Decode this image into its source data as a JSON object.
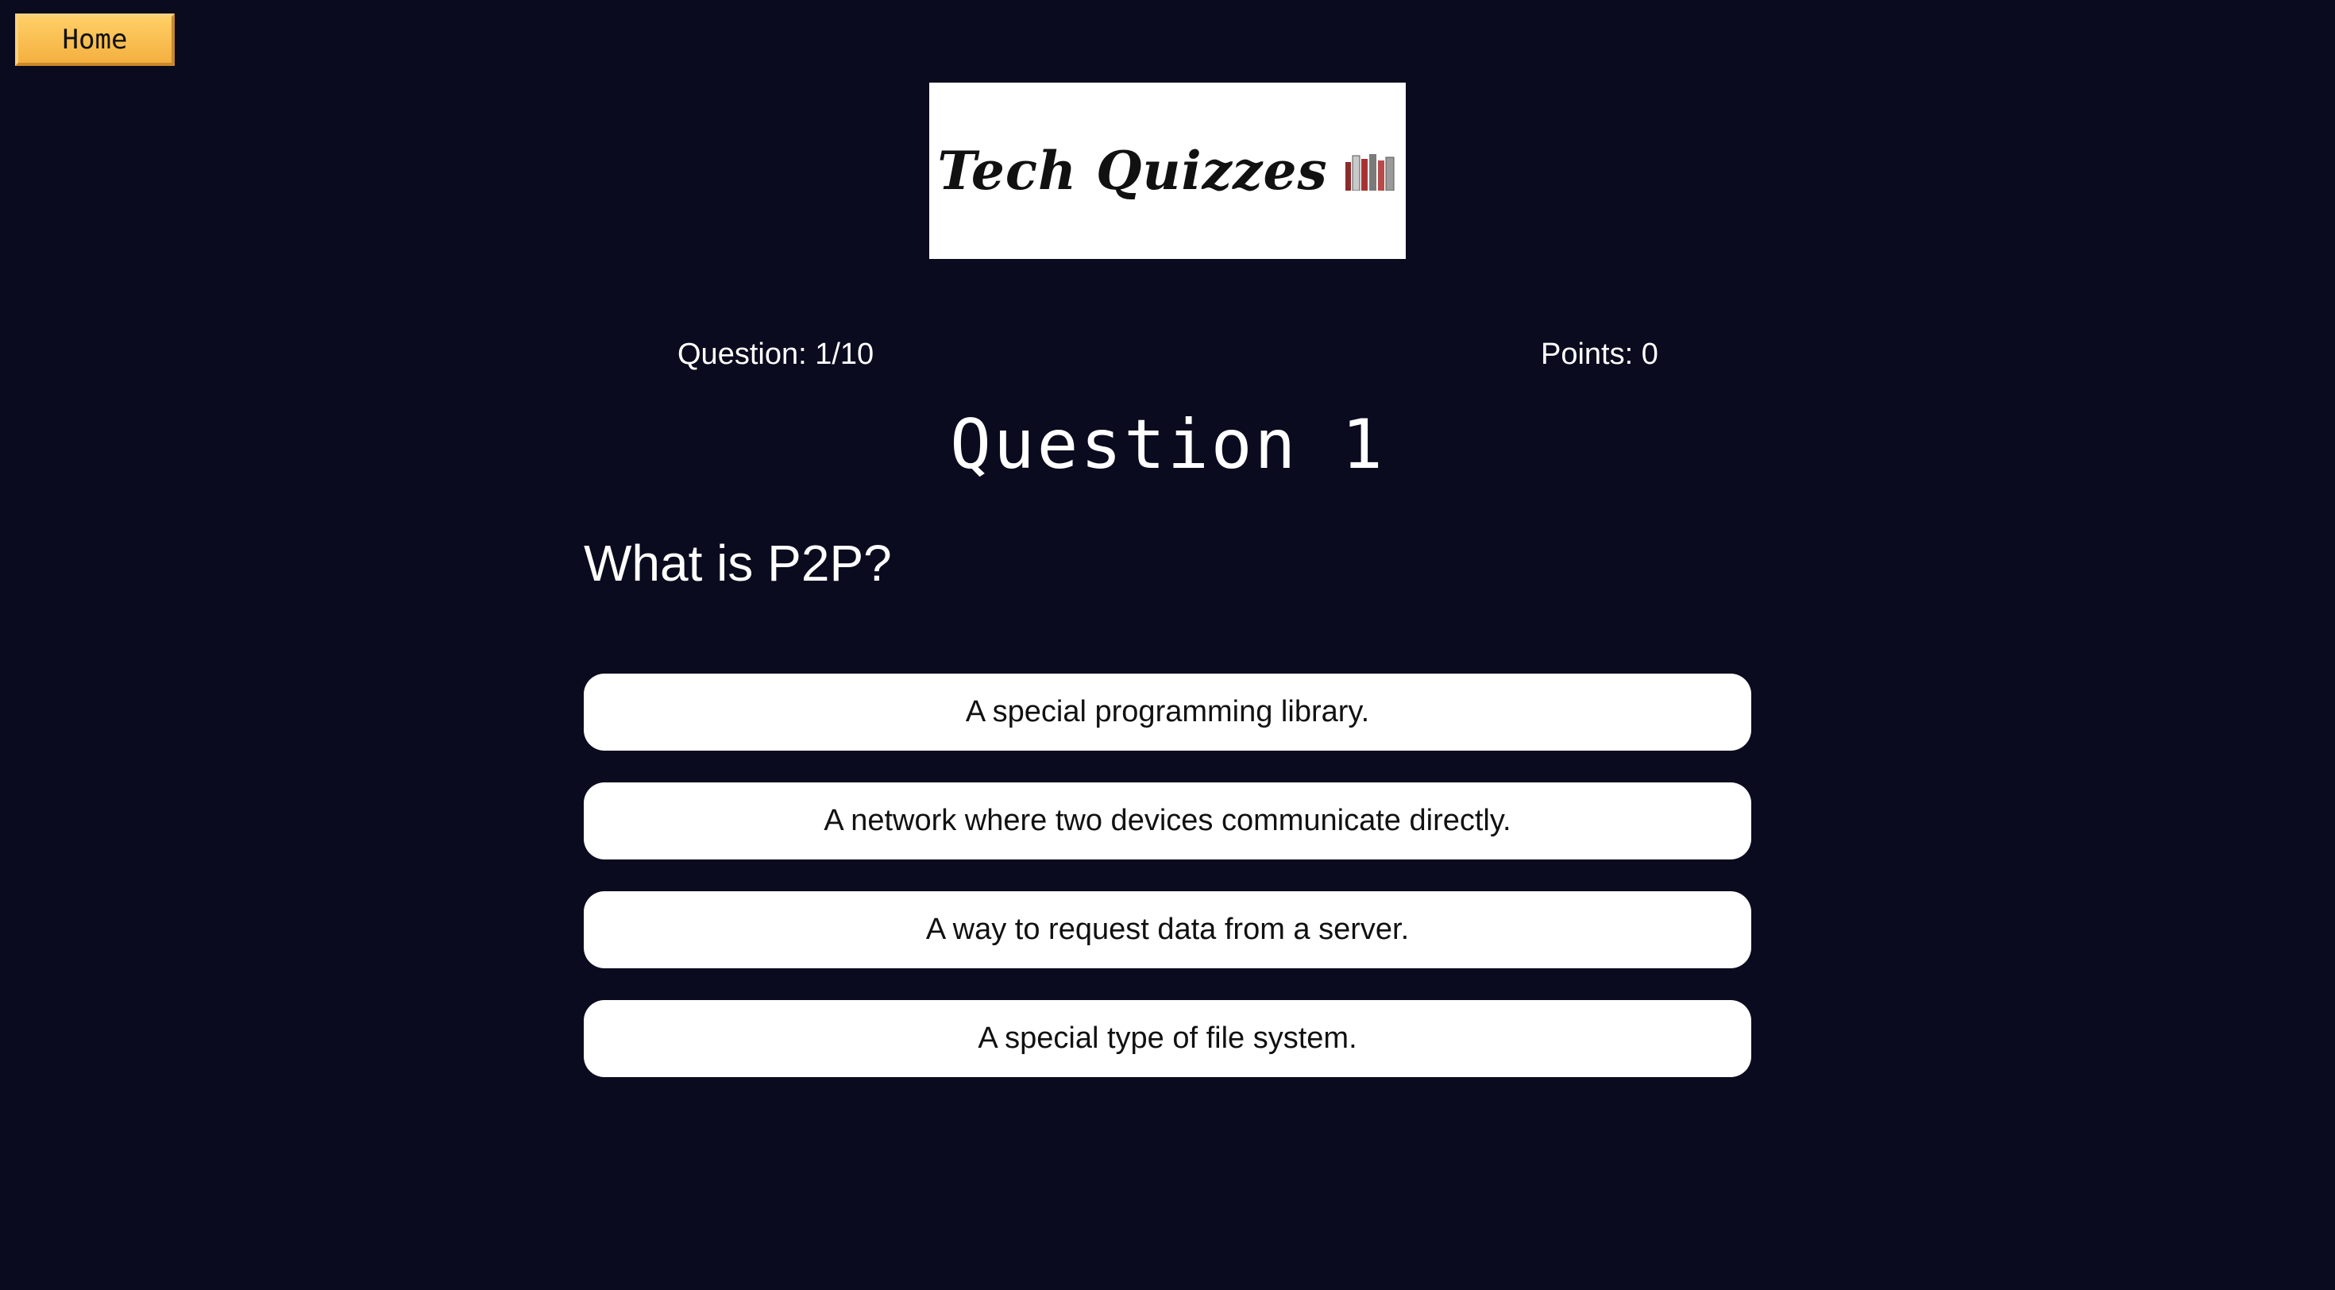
{
  "nav": {
    "home_label": "Home"
  },
  "logo": {
    "text": "Tech Quizzes",
    "icon": "books-icon"
  },
  "status": {
    "question_progress": "Question: 1/10",
    "points": "Points: 0"
  },
  "question": {
    "heading": "Question 1",
    "text": "What is P2P?"
  },
  "answers": [
    {
      "label": "A special programming library."
    },
    {
      "label": "A network where two devices communicate directly."
    },
    {
      "label": "A way to request data from a server."
    },
    {
      "label": "A special type of file system."
    }
  ],
  "colors": {
    "background": "#0a0b1e",
    "home_button": "#f4b040",
    "answer_background": "#ffffff",
    "text_light": "#ffffff",
    "text_dark": "#111111"
  }
}
